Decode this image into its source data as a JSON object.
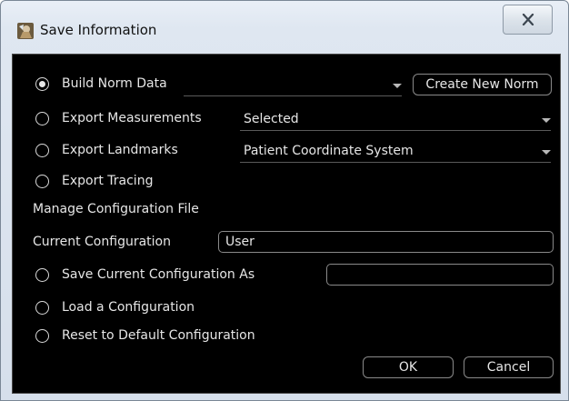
{
  "window": {
    "title": "Save Information"
  },
  "options": {
    "build_norm": {
      "label": "Build Norm Data",
      "selected": true,
      "dropdown_value": "",
      "create_button": "Create New Norm"
    },
    "export_measurements": {
      "label": "Export Measurements",
      "selected": false,
      "dropdown_value": "Selected"
    },
    "export_landmarks": {
      "label": "Export Landmarks",
      "selected": false,
      "dropdown_value": "Patient Coordinate System"
    },
    "export_tracing": {
      "label": "Export Tracing",
      "selected": false
    }
  },
  "config": {
    "section_label": "Manage Configuration File",
    "current_label": "Current Configuration",
    "current_value": "User",
    "save_as_label": "Save Current Configuration As",
    "save_as_value": "",
    "load_label": "Load a Configuration",
    "reset_label": "Reset to Default Configuration"
  },
  "buttons": {
    "ok": "OK",
    "cancel": "Cancel"
  },
  "icons": {
    "app": "app-icon",
    "close": "close-icon",
    "dropdown": "chevron-down-icon"
  }
}
